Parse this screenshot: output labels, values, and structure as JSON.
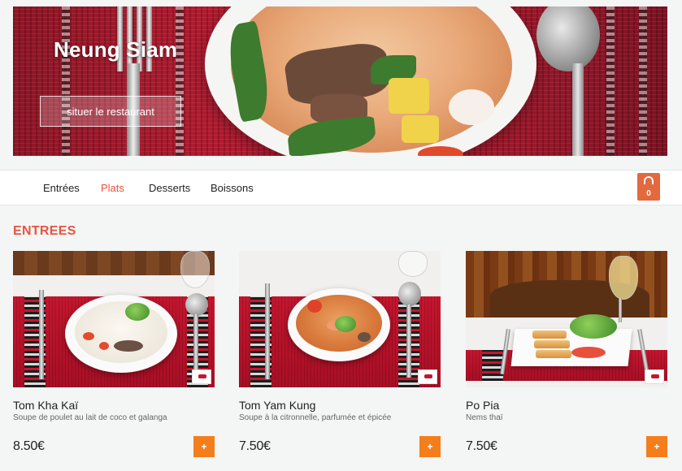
{
  "hero": {
    "title": "Neung Siam",
    "locate_button": "situer le restaurant"
  },
  "nav": {
    "items": [
      {
        "label": "Entrées",
        "active": false
      },
      {
        "label": "Plats",
        "active": true
      },
      {
        "label": "Desserts",
        "active": false
      },
      {
        "label": "Boissons",
        "active": false
      }
    ],
    "cart": {
      "icon": "shopping-bag-icon",
      "count": "0",
      "color": "#e26a3e"
    }
  },
  "section": {
    "title": "ENTREES",
    "color": "#e8553e"
  },
  "products": [
    {
      "name": "Tom Kha Kaï",
      "description": "Soupe de poulet au lait de coco et galanga",
      "price": "8.50€",
      "add_label": "+"
    },
    {
      "name": "Tom Yam Kung",
      "description": "Soupe à la citronnelle, parfumée et épicée",
      "price": "7.50€",
      "add_label": "+"
    },
    {
      "name": "Po Pia",
      "description": "Nems thaï",
      "price": "7.50€",
      "add_label": "+"
    }
  ],
  "colors": {
    "accent": "#f37e1b",
    "active_nav": "#e8533f"
  }
}
